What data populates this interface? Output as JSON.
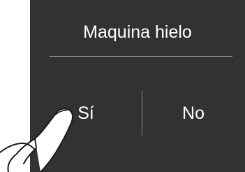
{
  "dialog": {
    "title": "Maquina hielo",
    "yes_label": "Sí",
    "no_label": "No"
  },
  "icons": {
    "pointer": "hand-pointer-icon"
  },
  "colors": {
    "dialog_background": "#323232",
    "text": "#ffffff",
    "divider": "#a8a8a8",
    "page_background": "#ffffff"
  }
}
